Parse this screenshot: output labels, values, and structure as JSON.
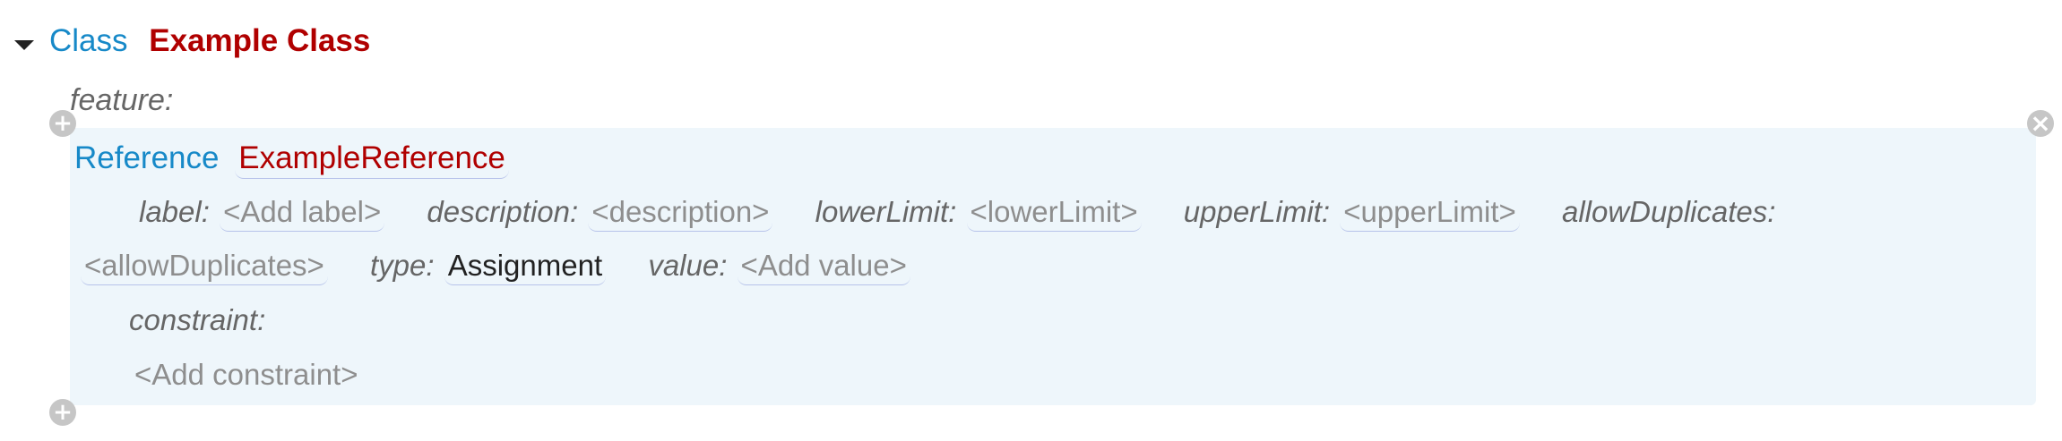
{
  "class_node": {
    "keyword": "Class",
    "name": "Example Class"
  },
  "feature": {
    "label": "feature:"
  },
  "reference": {
    "keyword": "Reference",
    "name": "ExampleReference",
    "label_field": {
      "label": "label:",
      "placeholder": "<Add label>"
    },
    "description_field": {
      "label": "description:",
      "placeholder": "<description>"
    },
    "lower_limit_field": {
      "label": "lowerLimit:",
      "placeholder": "<lowerLimit>"
    },
    "upper_limit_field": {
      "label": "upperLimit:",
      "placeholder": "<upperLimit>"
    },
    "allow_duplicates_field": {
      "label": "allowDuplicates:",
      "placeholder": "<allowDuplicates>"
    },
    "type_field": {
      "label": "type:",
      "value": "Assignment"
    },
    "value_field": {
      "label": "value:",
      "placeholder": "<Add value>"
    },
    "constraint": {
      "label": "constraint:",
      "placeholder": "<Add constraint>"
    }
  },
  "icons": {
    "add": "+",
    "remove": "×"
  },
  "colors": {
    "keyword": "#1789c8",
    "name": "#b00000",
    "panel_background": "#eef6fb",
    "slot_underline": "#b7c3ea",
    "icon_gray": "#c6c6c6"
  }
}
